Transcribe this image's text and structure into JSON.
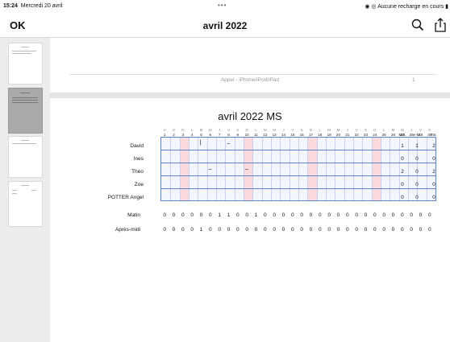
{
  "status": {
    "time": "15:24",
    "date": "Mercredi 20 avril",
    "right": "Aucune recharge en cours"
  },
  "nav": {
    "ok_label": "OK",
    "title": "avril 2022",
    "search_icon": "search-icon",
    "share_icon": "share-icon"
  },
  "prev_page": {
    "footer": "Appel - iPhone/iPod/iPad",
    "page_number": "1"
  },
  "report": {
    "title": "avril 2022 MS",
    "day_letters": [
      "V",
      "S",
      "D",
      "L",
      "M",
      "M",
      "J",
      "V",
      "S",
      "D",
      "L",
      "M",
      "M",
      "J",
      "V",
      "S",
      "D",
      "L",
      "M",
      "M",
      "J",
      "V",
      "S",
      "D",
      "L",
      "M",
      "M",
      "J",
      "V",
      "S"
    ],
    "day_numbers": [
      "1",
      "2",
      "3",
      "4",
      "5",
      "6",
      "7",
      "8",
      "9",
      "10",
      "11",
      "12",
      "13",
      "14",
      "15",
      "16",
      "17",
      "18",
      "19",
      "20",
      "21",
      "22",
      "23",
      "24",
      "25",
      "26",
      "27",
      "28",
      "29",
      "30"
    ],
    "summary_headers": [
      "Mat.",
      "A-M.",
      "Tot."
    ],
    "students": [
      {
        "name": "David",
        "mat": "1",
        "am": "1",
        "tot": "2"
      },
      {
        "name": "Ines",
        "mat": "0",
        "am": "0",
        "tot": "0"
      },
      {
        "name": "Théo",
        "mat": "2",
        "am": "0",
        "tot": "2"
      },
      {
        "name": "Zoe",
        "mat": "0",
        "am": "0",
        "tot": "0"
      },
      {
        "name": "POTTER Angel",
        "mat": "0",
        "am": "0",
        "tot": "0"
      }
    ],
    "matin_label": "Matin",
    "matin_counts": [
      "0",
      "0",
      "0",
      "0",
      "0",
      "0",
      "1",
      "1",
      "0",
      "0",
      "1",
      "0",
      "0",
      "0",
      "0",
      "0",
      "0",
      "0",
      "0",
      "0",
      "0",
      "0",
      "0",
      "0",
      "0",
      "0",
      "0",
      "0",
      "0",
      "0"
    ],
    "apresmidi_label": "Après-midi",
    "apresmidi_counts": [
      "0",
      "0",
      "0",
      "0",
      "1",
      "0",
      "0",
      "0",
      "0",
      "0",
      "0",
      "0",
      "0",
      "0",
      "0",
      "0",
      "0",
      "0",
      "0",
      "0",
      "0",
      "0",
      "0",
      "0",
      "0",
      "0",
      "0",
      "0",
      "0",
      "0"
    ]
  }
}
